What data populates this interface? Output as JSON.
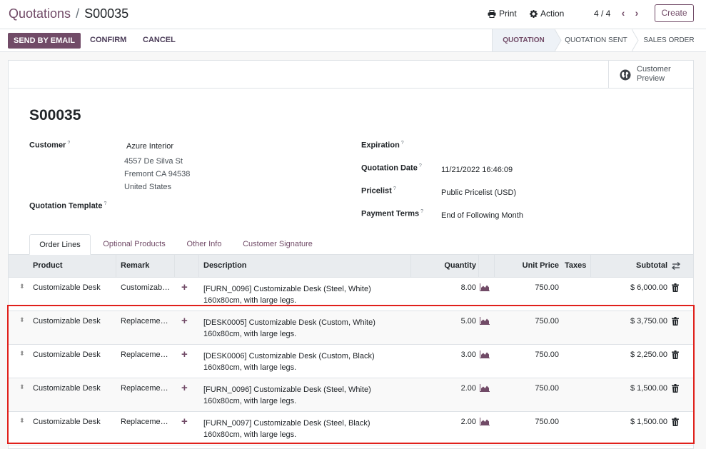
{
  "breadcrumb": {
    "parent": "Quotations",
    "separator": "/",
    "current": "S00035"
  },
  "toolbar": {
    "print_label": "Print",
    "action_label": "Action",
    "pager": "4 / 4",
    "create_label": "Create"
  },
  "header_buttons": {
    "send_by_email": "SEND BY EMAIL",
    "confirm": "CONFIRM",
    "cancel": "CANCEL"
  },
  "statusbar": {
    "quotation": "QUOTATION",
    "quotation_sent": "QUOTATION SENT",
    "sales_order": "SALES ORDER"
  },
  "preview": {
    "line1": "Customer",
    "line2": "Preview"
  },
  "form": {
    "title": "S00035",
    "help_mark": "?",
    "customer_label": "Customer",
    "customer_name": "Azure Interior",
    "customer_street": "4557 De Silva St",
    "customer_city": "Fremont CA 94538",
    "customer_country": "United States",
    "quotation_template_label": "Quotation Template",
    "expiration_label": "Expiration",
    "quotation_date_label": "Quotation Date",
    "quotation_date_value": "11/21/2022 16:46:09",
    "pricelist_label": "Pricelist",
    "pricelist_value": "Public Pricelist (USD)",
    "payment_terms_label": "Payment Terms",
    "payment_terms_value": "End of Following Month"
  },
  "tabs": [
    "Order Lines",
    "Optional Products",
    "Other Info",
    "Customer Signature"
  ],
  "table": {
    "columns": {
      "product": "Product",
      "remark": "Remark",
      "description": "Description",
      "quantity": "Quantity",
      "unit_price": "Unit Price",
      "taxes": "Taxes",
      "subtotal": "Subtotal"
    },
    "rows": [
      {
        "product": "Customizable Desk",
        "remark": "Customizab…",
        "desc1": "[FURN_0096] Customizable Desk (Steel, White)",
        "desc2": "160x80cm, with large legs.",
        "quantity": "8.00",
        "unit_price": "750.00",
        "subtotal": "$ 6,000.00"
      },
      {
        "product": "Customizable Desk",
        "remark": "Replaceme…",
        "desc1": "[DESK0005] Customizable Desk (Custom, White)",
        "desc2": "160x80cm, with large legs.",
        "quantity": "5.00",
        "unit_price": "750.00",
        "subtotal": "$ 3,750.00"
      },
      {
        "product": "Customizable Desk",
        "remark": "Replaceme…",
        "desc1": "[DESK0006] Customizable Desk (Custom, Black)",
        "desc2": "160x80cm, with large legs.",
        "quantity": "3.00",
        "unit_price": "750.00",
        "subtotal": "$ 2,250.00"
      },
      {
        "product": "Customizable Desk",
        "remark": "Replaceme…",
        "desc1": "[FURN_0096] Customizable Desk (Steel, White)",
        "desc2": "160x80cm, with large legs.",
        "quantity": "2.00",
        "unit_price": "750.00",
        "subtotal": "$ 1,500.00"
      },
      {
        "product": "Customizable Desk",
        "remark": "Replaceme…",
        "desc1": "[FURN_0097] Customizable Desk (Steel, Black)",
        "desc2": "160x80cm, with large legs.",
        "quantity": "2.00",
        "unit_price": "750.00",
        "subtotal": "$ 1,500.00"
      }
    ]
  },
  "colors": {
    "brand": "#714b67",
    "highlight": "#e0201b"
  }
}
